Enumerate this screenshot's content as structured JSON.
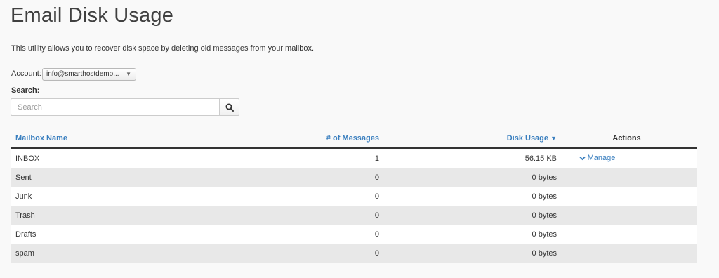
{
  "page": {
    "title": "Email Disk Usage",
    "description": "This utility allows you to recover disk space by deleting old messages from your mailbox."
  },
  "account": {
    "label": "Account:",
    "selected": "info@smarthostdemo..."
  },
  "search": {
    "label": "Search:",
    "placeholder": "Search",
    "value": ""
  },
  "table": {
    "headers": {
      "mailbox_name": "Mailbox Name",
      "messages": "# of Messages",
      "disk_usage": "Disk Usage",
      "sort_indicator": "▼",
      "actions": "Actions"
    },
    "rows": [
      {
        "name": "INBOX",
        "messages": "1",
        "disk_usage": "56.15 KB",
        "action": "Manage"
      },
      {
        "name": "Sent",
        "messages": "0",
        "disk_usage": "0 bytes",
        "action": ""
      },
      {
        "name": "Junk",
        "messages": "0",
        "disk_usage": "0 bytes",
        "action": ""
      },
      {
        "name": "Trash",
        "messages": "0",
        "disk_usage": "0 bytes",
        "action": ""
      },
      {
        "name": "Drafts",
        "messages": "0",
        "disk_usage": "0 bytes",
        "action": ""
      },
      {
        "name": "spam",
        "messages": "0",
        "disk_usage": "0 bytes",
        "action": ""
      }
    ]
  },
  "icons": {
    "search": "search-icon",
    "chevron": "chevron-down-icon",
    "caret": "caret-down-icon"
  },
  "colors": {
    "link": "#3a7fbf",
    "row_stripe": "#e8e8e8",
    "background": "#f9f9f9"
  }
}
